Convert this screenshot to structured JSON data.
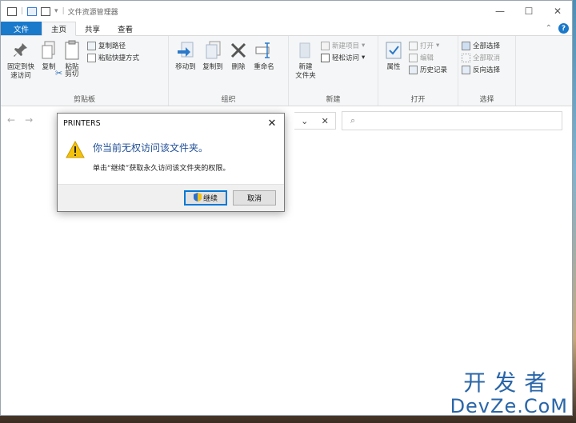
{
  "window": {
    "title": "文件资源管理器",
    "minimize": "—",
    "maximize": "☐",
    "close": "✕"
  },
  "tabs": [
    {
      "label": "文件"
    },
    {
      "label": "主页"
    },
    {
      "label": "共享"
    },
    {
      "label": "查看"
    }
  ],
  "ribbon": {
    "clipboard": {
      "label": "剪贴板",
      "pin": "固定到快速访问",
      "pin_line1": "固定到快",
      "pin_line2": "速访问",
      "copy": "复制",
      "paste": "粘贴",
      "copy_path": "复制路径",
      "paste_shortcut": "粘贴快捷方式",
      "cut": "剪切"
    },
    "organize": {
      "label": "组织",
      "move_to": "移动到",
      "copy_to": "复制到",
      "delete": "删除",
      "rename": "重命名"
    },
    "new": {
      "label": "新建",
      "new_folder_line1": "新建",
      "new_folder_line2": "文件夹",
      "new_item": "新建项目",
      "easy_access": "轻松访问"
    },
    "open": {
      "label": "打开",
      "properties": "属性",
      "open": "打开",
      "edit": "编辑",
      "history": "历史记录"
    },
    "select": {
      "label": "选择",
      "select_all": "全部选择",
      "select_none": "全部取消",
      "invert": "反向选择"
    }
  },
  "nav": {
    "back": "←",
    "forward": "→",
    "dropdown": "⌄",
    "clear": "✕",
    "search_icon": "⌕"
  },
  "dialog": {
    "title": "PRINTERS",
    "close": "✕",
    "message": "你当前无权访问该文件夹。",
    "detail": "单击“继续”获取永久访问该文件夹的权限。",
    "continue": "继续",
    "cancel": "取消"
  },
  "watermark": {
    "line1": "开发者",
    "line2": "DevZe.CoM"
  },
  "colors": {
    "accent": "#1979ca",
    "dialog_text": "#1f4e96",
    "warning": "#f4c20d",
    "watermark": "#2a66a8"
  }
}
